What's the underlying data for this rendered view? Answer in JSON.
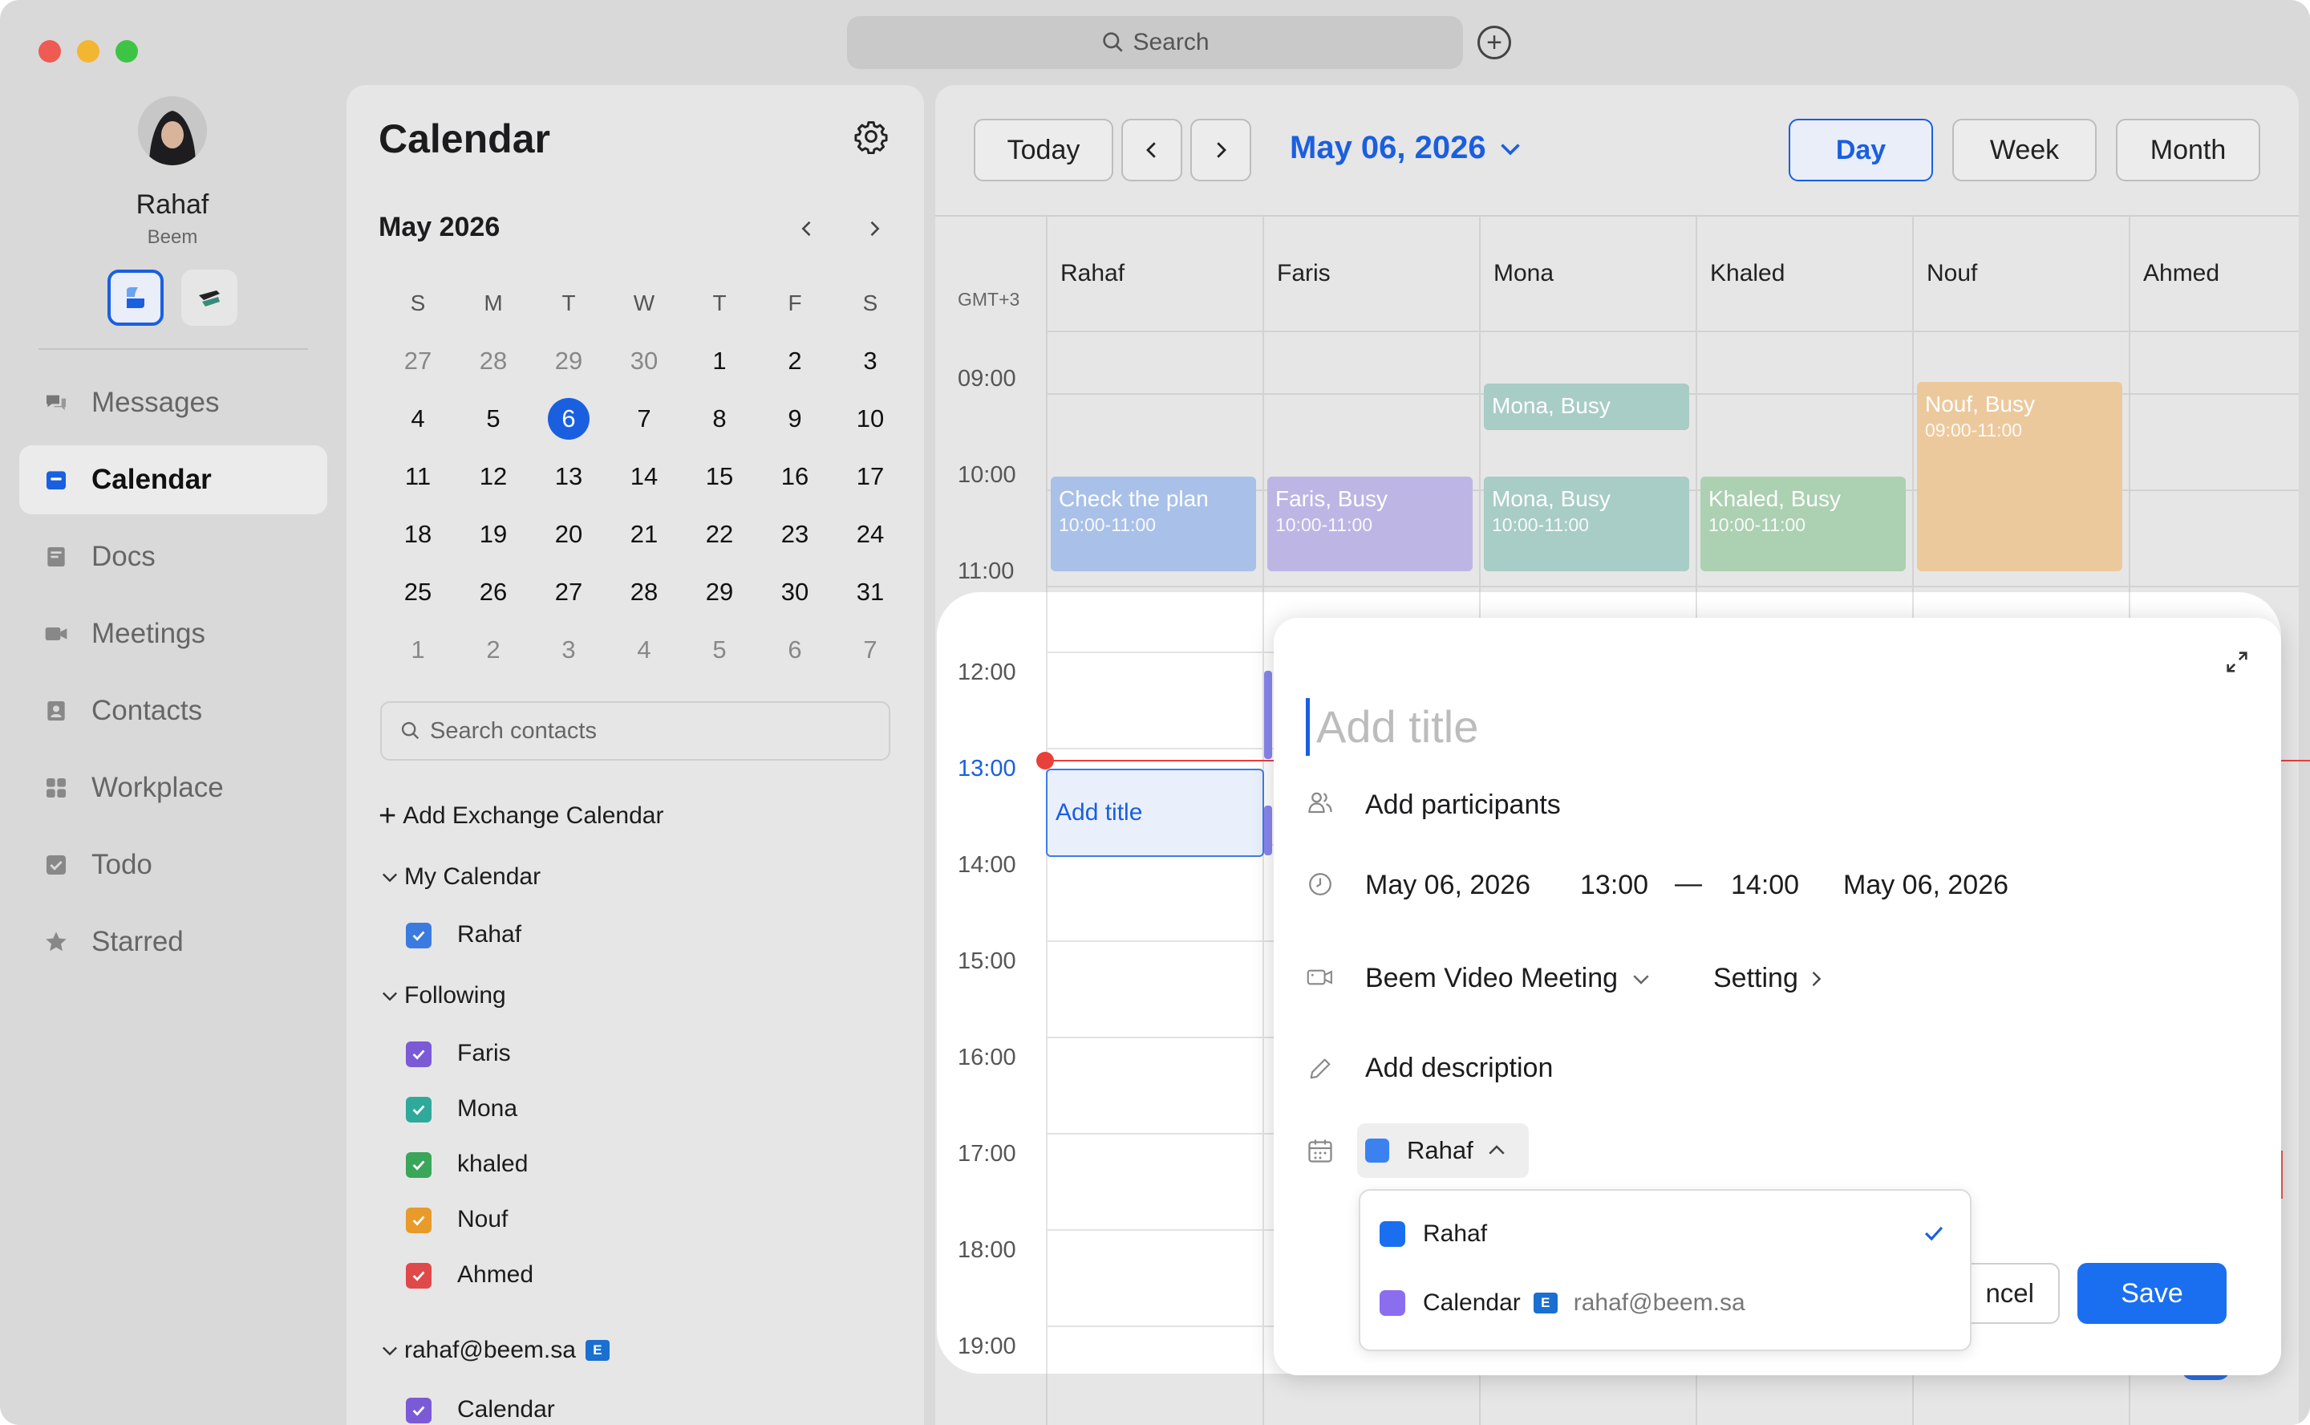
{
  "window": {
    "search_placeholder": "Search"
  },
  "user": {
    "name": "Rahaf",
    "org": "Beem"
  },
  "nav": {
    "items": [
      {
        "label": "Messages",
        "icon": "messages-icon"
      },
      {
        "label": "Calendar",
        "icon": "calendar-icon",
        "active": true
      },
      {
        "label": "Docs",
        "icon": "docs-icon"
      },
      {
        "label": "Meetings",
        "icon": "meetings-icon"
      },
      {
        "label": "Contacts",
        "icon": "contacts-icon"
      },
      {
        "label": "Workplace",
        "icon": "workplace-icon"
      },
      {
        "label": "Todo",
        "icon": "todo-icon"
      },
      {
        "label": "Starred",
        "icon": "star-icon"
      }
    ]
  },
  "panel": {
    "title": "Calendar",
    "month_title": "May 2026",
    "weekdays": [
      "S",
      "M",
      "T",
      "W",
      "T",
      "F",
      "S"
    ],
    "weeks": [
      [
        "27",
        "28",
        "29",
        "30",
        "1",
        "2",
        "3"
      ],
      [
        "4",
        "5",
        "6",
        "7",
        "8",
        "9",
        "10"
      ],
      [
        "11",
        "12",
        "13",
        "14",
        "15",
        "16",
        "17"
      ],
      [
        "18",
        "19",
        "20",
        "21",
        "22",
        "23",
        "24"
      ],
      [
        "25",
        "26",
        "27",
        "28",
        "29",
        "30",
        "31"
      ],
      [
        "1",
        "2",
        "3",
        "4",
        "5",
        "6",
        "7"
      ]
    ],
    "selected_day": "6",
    "search_contacts_placeholder": "Search contacts",
    "add_exchange": "Add Exchange Calendar",
    "my_calendar_label": "My Calendar",
    "my_calendars": [
      {
        "label": "Rahaf",
        "color": "#3b7be0"
      }
    ],
    "following_label": "Following",
    "following": [
      {
        "label": "Faris",
        "color": "#7b5ad6"
      },
      {
        "label": "Mona",
        "color": "#2fa99a"
      },
      {
        "label": "khaled",
        "color": "#3aa65a"
      },
      {
        "label": "Nouf",
        "color": "#e89a2a"
      },
      {
        "label": "Ahmed",
        "color": "#e0494a"
      }
    ],
    "exchange_account": "rahaf@beem.sa",
    "exchange_calendars": [
      {
        "label": "Calendar",
        "color": "#7b5ad6"
      }
    ]
  },
  "toolbar": {
    "today": "Today",
    "date": "May 06, 2026",
    "day": "Day",
    "week": "Week",
    "month": "Month"
  },
  "grid": {
    "timezone": "GMT+3",
    "columns": [
      "Rahaf",
      "Faris",
      "Mona",
      "Khaled",
      "Nouf",
      "Ahmed"
    ],
    "times": [
      "09:00",
      "10:00",
      "11:00",
      "12:00",
      "13:00",
      "14:00",
      "15:00",
      "16:00",
      "17:00",
      "18:00",
      "19:00"
    ],
    "current_time": "13:00"
  },
  "events": [
    {
      "title": "Mona, Busy",
      "time": "",
      "column": "Mona",
      "color": "#a8ccc6"
    },
    {
      "title": "Nouf, Busy",
      "time": "09:00-11:00",
      "column": "Nouf",
      "color": "#ecc99c"
    },
    {
      "title": "Check the plan",
      "time": "10:00-11:00",
      "column": "Rahaf",
      "color": "#a9c1e8"
    },
    {
      "title": "Faris, Busy",
      "time": "10:00-11:00",
      "column": "Faris",
      "color": "#bdb6e4"
    },
    {
      "title": "Mona, Busy",
      "time": "10:00-11:00",
      "column": "Mona",
      "color": "#a8ccc6"
    },
    {
      "title": "Khaled, Busy",
      "time": "10:00-11:00",
      "column": "Khaled",
      "color": "#acd0b2"
    }
  ],
  "draft_event": {
    "label": "Add title"
  },
  "dialog": {
    "title_placeholder": "Add title",
    "participants": "Add participants",
    "start_date": "May 06, 2026",
    "start_time": "13:00",
    "separator": "—",
    "end_time": "14:00",
    "end_date": "May 06, 2026",
    "meeting": "Beem Video Meeting",
    "setting": "Setting",
    "description": "Add description",
    "calendar": "Rahaf",
    "calendar_color": "#3b82f0",
    "cancel": "ncel",
    "save": "Save"
  },
  "calendar_dropdown": {
    "options": [
      {
        "label": "Rahaf",
        "color": "#1a6ff0",
        "selected": true,
        "sub": ""
      },
      {
        "label": "Calendar",
        "color": "#8b6ef0",
        "selected": false,
        "sub": "rahaf@beem.sa"
      }
    ]
  }
}
